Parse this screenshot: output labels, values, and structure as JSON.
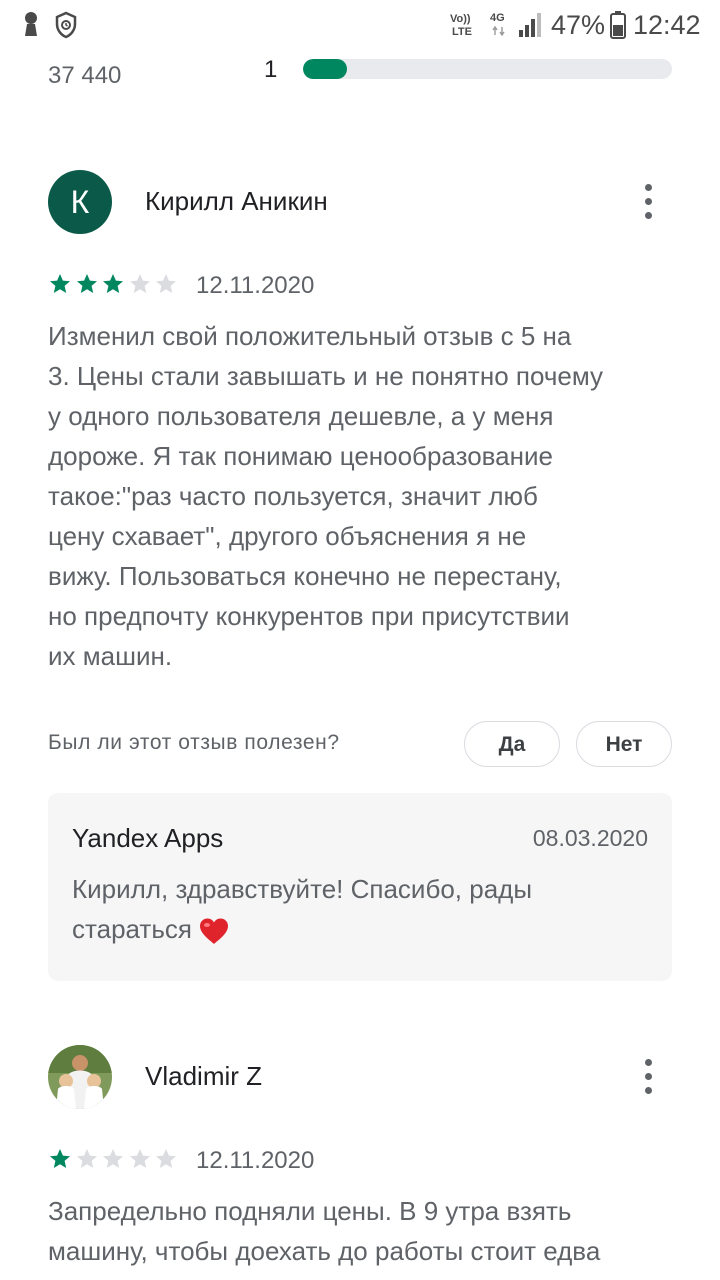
{
  "status_bar": {
    "volte_top": "Vo))",
    "volte_bottom": "LTE",
    "network": "4G",
    "battery": "47%",
    "time": "12:42"
  },
  "rating_summary": {
    "total_count": "37 440",
    "bar_label": "1",
    "bar_fill_fraction": 0.12
  },
  "reviews": [
    {
      "avatar_letter": "К",
      "author": "Кирилл Аникин",
      "rating": 3,
      "date": "12.11.2020",
      "text": "Изменил свой положительный отзыв с 5 на\n3. Цены стали завышать и не понятно почему\nу одного пользователя дешевле, а у меня\nдороже. Я так понимаю ценообразование\nтакое:\"раз часто пользуется, значит люб\nцену схавает\", другого объяснения я не\nвижу. Пользоваться конечно не перестану,\nно предпочту конкурентов при присутствии\nих машин.",
      "helpful_question": "Был ли этот отзыв полезен?",
      "yes_label": "Да",
      "no_label": "Нет",
      "reply": {
        "author": "Yandex Apps",
        "date": "08.03.2020",
        "text": "Кирилл, здравствуйте! Спасибо, рады\nстараться"
      }
    },
    {
      "author": "Vladimir Z",
      "rating": 1,
      "date": "12.11.2020",
      "text": "Запредельно подняли цены. В 9 утра взять\nмашину, чтобы доехать до работы стоит едва"
    }
  ],
  "colors": {
    "star_filled": "#01875f",
    "star_empty": "#dadce0",
    "avatar_bg": "#0b5a49",
    "heart": "#e0242b"
  },
  "icons": [
    "person-icon",
    "shield-icon",
    "signal-icon",
    "battery-icon",
    "star-icon",
    "more-vert-icon",
    "heart-icon"
  ]
}
